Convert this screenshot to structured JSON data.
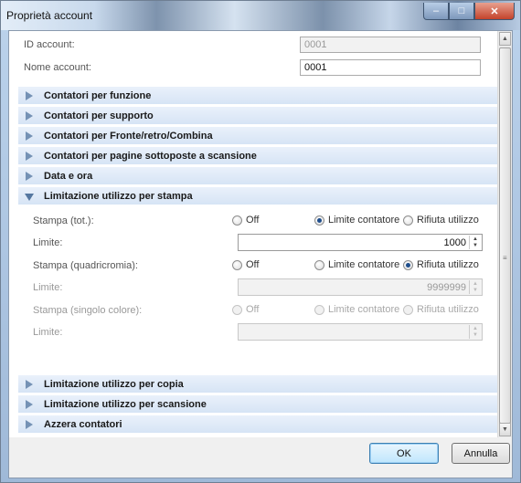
{
  "window": {
    "title": "Proprietà account",
    "minimize_icon": "minimize-icon",
    "maximize_icon": "maximize-icon",
    "close_icon": "close-icon"
  },
  "fields": {
    "id_label": "ID account:",
    "id_value": "0001",
    "name_label": "Nome account:",
    "name_value": "0001"
  },
  "sections": [
    {
      "title": "Contatori per funzione",
      "expanded": false
    },
    {
      "title": "Contatori per supporto",
      "expanded": false
    },
    {
      "title": "Contatori per Fronte/retro/Combina",
      "expanded": false
    },
    {
      "title": "Contatori per pagine sottoposte a scansione",
      "expanded": false
    },
    {
      "title": "Data e ora",
      "expanded": false
    },
    {
      "title": "Limitazione utilizzo per stampa",
      "expanded": true
    },
    {
      "title": "Limitazione utilizzo per copia",
      "expanded": false
    },
    {
      "title": "Limitazione utilizzo per scansione",
      "expanded": false
    },
    {
      "title": "Azzera contatori",
      "expanded": false
    }
  ],
  "print_limits": {
    "total": {
      "label": "Stampa (tot.):",
      "options": [
        "Off",
        "Limite contatore",
        "Rifiuta utilizzo"
      ],
      "selected": "Limite contatore",
      "limit_label": "Limite:",
      "limit_value": "1000"
    },
    "color": {
      "label": "Stampa (quadricromia):",
      "options": [
        "Off",
        "Limite contatore",
        "Rifiuta utilizzo"
      ],
      "selected": "Rifiuta utilizzo",
      "limit_label": "Limite:",
      "limit_value": "9999999"
    },
    "mono": {
      "label": "Stampa (singolo colore):",
      "options": [
        "Off",
        "Limite contatore",
        "Rifiuta utilizzo"
      ],
      "selected": "",
      "limit_label": "Limite:",
      "limit_value": ""
    }
  },
  "buttons": {
    "ok": "OK",
    "cancel": "Annulla"
  },
  "colors": {
    "section_bg": "#dde8f6",
    "section_arrow": "#7592b5",
    "radio_selected": "#1f4e8c",
    "default_button_border": "#3c7fb1"
  }
}
